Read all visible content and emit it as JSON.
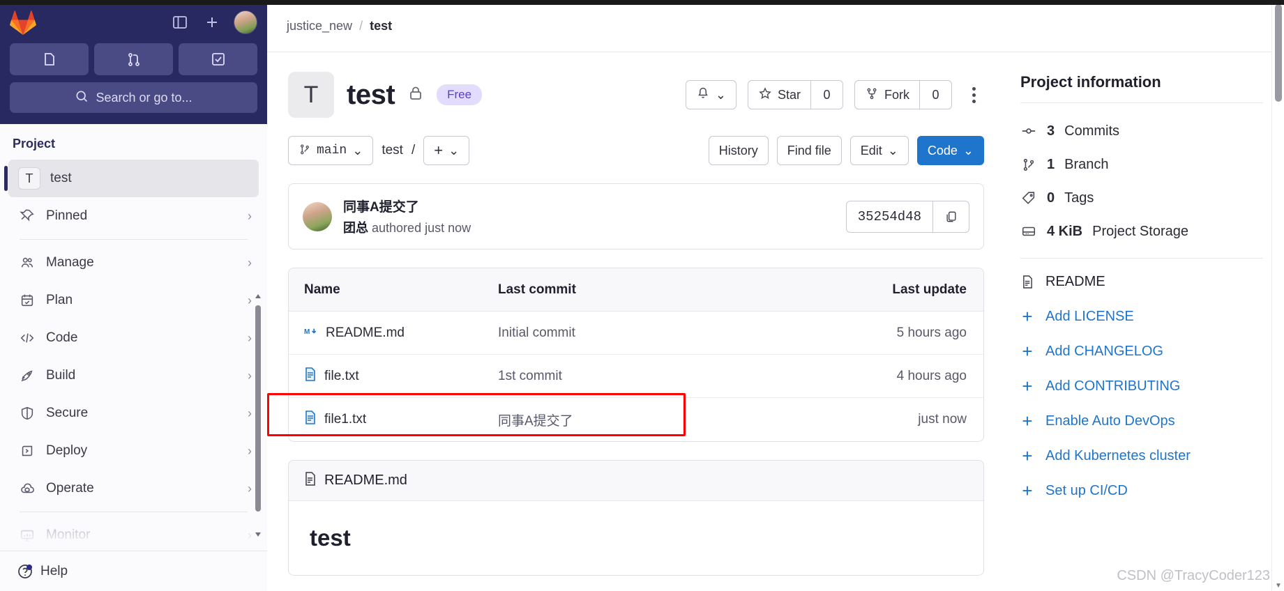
{
  "sidebar": {
    "logo": "gitlab-logo",
    "top_icons": [
      {
        "name": "toggle-sidebar-icon"
      },
      {
        "name": "plus-icon"
      },
      {
        "name": "user-avatar"
      }
    ],
    "quick_buttons": [
      {
        "name": "issues-icon"
      },
      {
        "name": "merge-requests-icon"
      },
      {
        "name": "todos-icon"
      }
    ],
    "search_placeholder": "Search or go to...",
    "section_title": "Project",
    "items": [
      {
        "label": "test",
        "icon": "project-letter-avatar",
        "badge": "T",
        "active": true,
        "chevron": false
      },
      {
        "label": "Pinned",
        "icon": "pin-icon",
        "chevron": true
      },
      {
        "label": "Manage",
        "icon": "users-icon",
        "chevron": true
      },
      {
        "label": "Plan",
        "icon": "calendar-icon",
        "chevron": true
      },
      {
        "label": "Code",
        "icon": "code-icon",
        "chevron": true
      },
      {
        "label": "Build",
        "icon": "rocket-icon",
        "chevron": true
      },
      {
        "label": "Secure",
        "icon": "shield-icon",
        "chevron": true
      },
      {
        "label": "Deploy",
        "icon": "deploy-icon",
        "chevron": true
      },
      {
        "label": "Operate",
        "icon": "cloud-cube-icon",
        "chevron": true
      },
      {
        "label": "Monitor",
        "icon": "monitor-icon",
        "chevron": true,
        "muted": true
      }
    ],
    "help_label": "Help"
  },
  "breadcrumb": {
    "group": "justice_new",
    "separator": "/",
    "project": "test"
  },
  "project": {
    "avatar_letter": "T",
    "title": "test",
    "visibility_icon": "lock-icon",
    "tier_badge": "Free",
    "notification_icon": "bell-icon",
    "star_label": "Star",
    "star_count": "0",
    "fork_label": "Fork",
    "fork_count": "0",
    "more_actions": "kebab-menu"
  },
  "toolbar": {
    "branch": "main",
    "path": "test",
    "path_separator": "/",
    "add_button": "+",
    "history_label": "History",
    "find_file_label": "Find file",
    "edit_label": "Edit",
    "code_label": "Code"
  },
  "commit": {
    "message": "同事A提交了",
    "author": "团总",
    "authored_text": "authored just now",
    "sha": "35254d48",
    "copy_icon": "copy-icon"
  },
  "files": {
    "columns": [
      "Name",
      "Last commit",
      "Last update"
    ],
    "rows": [
      {
        "name": "README.md",
        "icon": "markdown-icon",
        "commit": "Initial commit",
        "update": "5 hours ago",
        "highlight": false
      },
      {
        "name": "file.txt",
        "icon": "file-icon",
        "commit": "1st commit",
        "update": "4 hours ago",
        "highlight": false
      },
      {
        "name": "file1.txt",
        "icon": "file-icon",
        "commit": "同事A提交了",
        "update": "just now",
        "highlight": true
      }
    ]
  },
  "readme": {
    "filename": "README.md",
    "file_icon": "doc-icon",
    "heading": "test"
  },
  "project_info": {
    "title": "Project information",
    "stats": [
      {
        "icon": "commit-icon",
        "value": "3",
        "label": "Commits"
      },
      {
        "icon": "branch-icon",
        "value": "1",
        "label": "Branch"
      },
      {
        "icon": "tag-icon",
        "value": "0",
        "label": "Tags"
      },
      {
        "icon": "storage-icon",
        "value": "4 KiB",
        "label": "Project Storage"
      }
    ],
    "links": [
      {
        "label": "README",
        "icon": "doc-icon",
        "type": "plain"
      },
      {
        "label": "Add LICENSE",
        "icon": "plus-icon",
        "type": "link"
      },
      {
        "label": "Add CHANGELOG",
        "icon": "plus-icon",
        "type": "link"
      },
      {
        "label": "Add CONTRIBUTING",
        "icon": "plus-icon",
        "type": "link"
      },
      {
        "label": "Enable Auto DevOps",
        "icon": "plus-icon",
        "type": "link"
      },
      {
        "label": "Add Kubernetes cluster",
        "icon": "plus-icon",
        "type": "link"
      },
      {
        "label": "Set up CI/CD",
        "icon": "plus-icon",
        "type": "link"
      }
    ]
  },
  "watermark": "CSDN @TracyCoder123",
  "colors": {
    "sidebar_top": "#292961",
    "accent_blue": "#1f75cb",
    "highlight_red": "#ff0000",
    "badge_purple_bg": "#e3dcfc",
    "badge_purple_fg": "#5a3ec8"
  }
}
